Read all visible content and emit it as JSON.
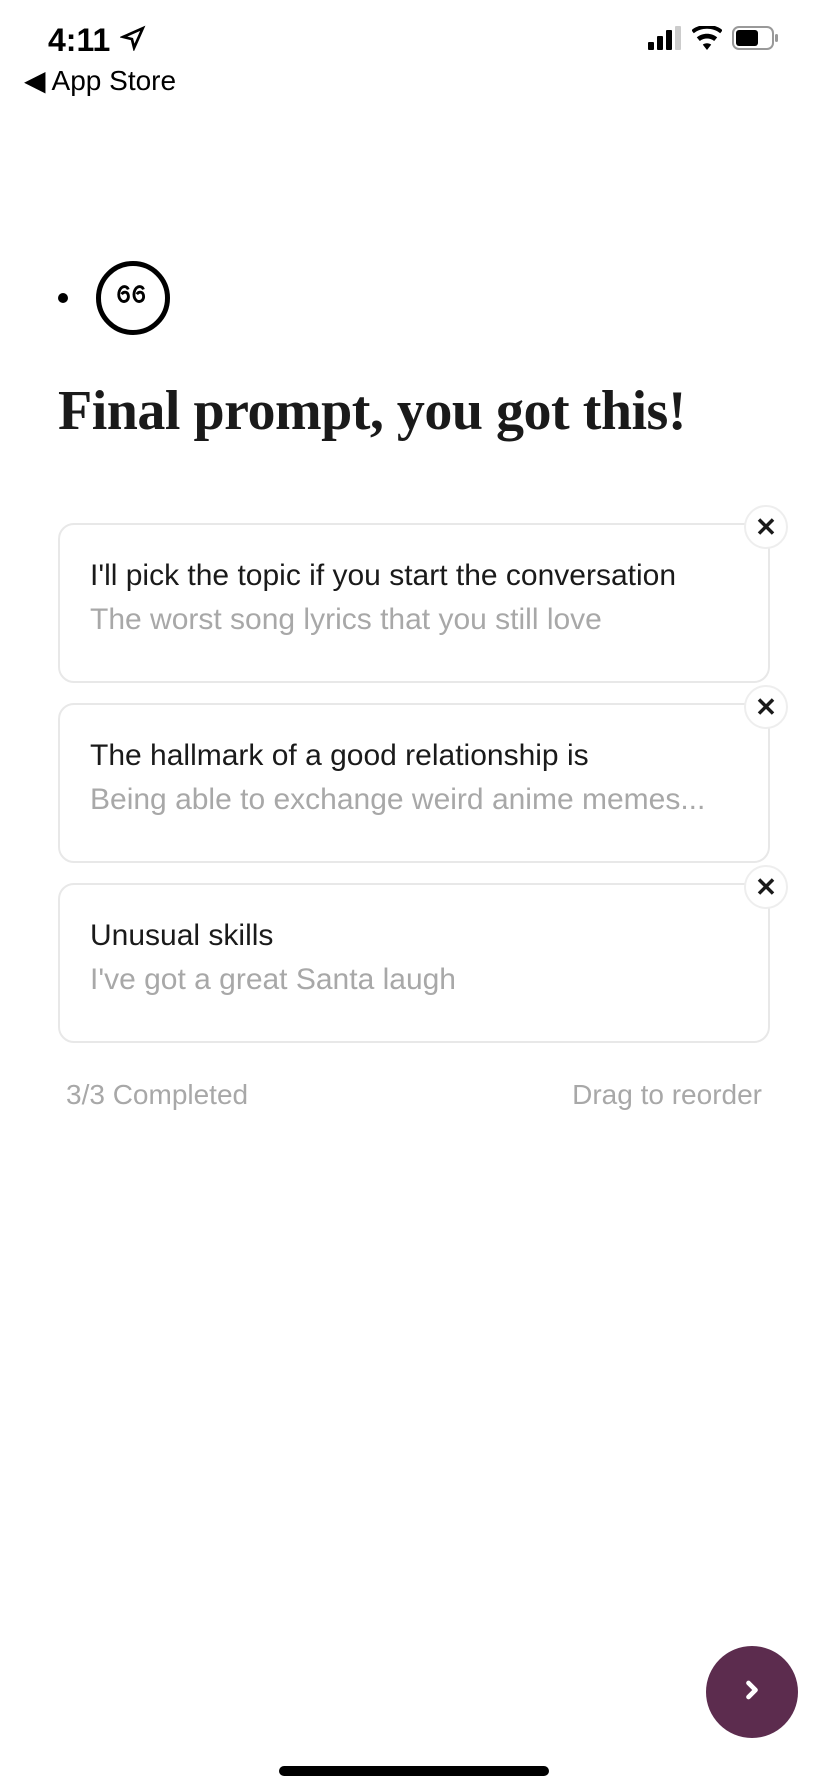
{
  "statusBar": {
    "time": "4:11",
    "breadcrumb": "App Store"
  },
  "page": {
    "title": "Final prompt, you got this!"
  },
  "prompts": [
    {
      "title": "I'll pick the topic if you start the conversation",
      "answer": "The worst song lyrics that you still love"
    },
    {
      "title": "The hallmark of a good relationship is",
      "answer": "Being able to exchange weird anime memes..."
    },
    {
      "title": "Unusual skills",
      "answer": "I've got a great Santa laugh"
    }
  ],
  "footer": {
    "completed": "3/3 Completed",
    "reorder": "Drag to reorder"
  },
  "colors": {
    "accent": "#5c2c4e"
  }
}
